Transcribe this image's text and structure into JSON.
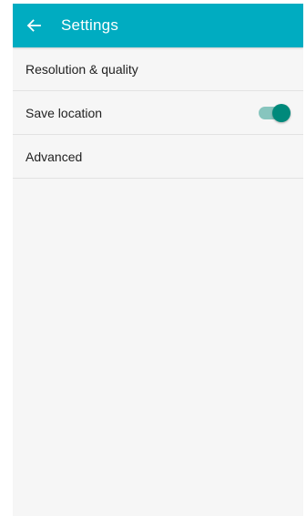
{
  "colors": {
    "app_bar": "#00acc1",
    "toggle_on": "#00897b",
    "background": "#f6f6f6"
  },
  "header": {
    "back_icon": "arrow-left-icon",
    "title": "Settings"
  },
  "settings": {
    "items": [
      {
        "label": "Resolution & quality"
      },
      {
        "label": "Save location",
        "toggle": true
      },
      {
        "label": "Advanced"
      }
    ]
  }
}
